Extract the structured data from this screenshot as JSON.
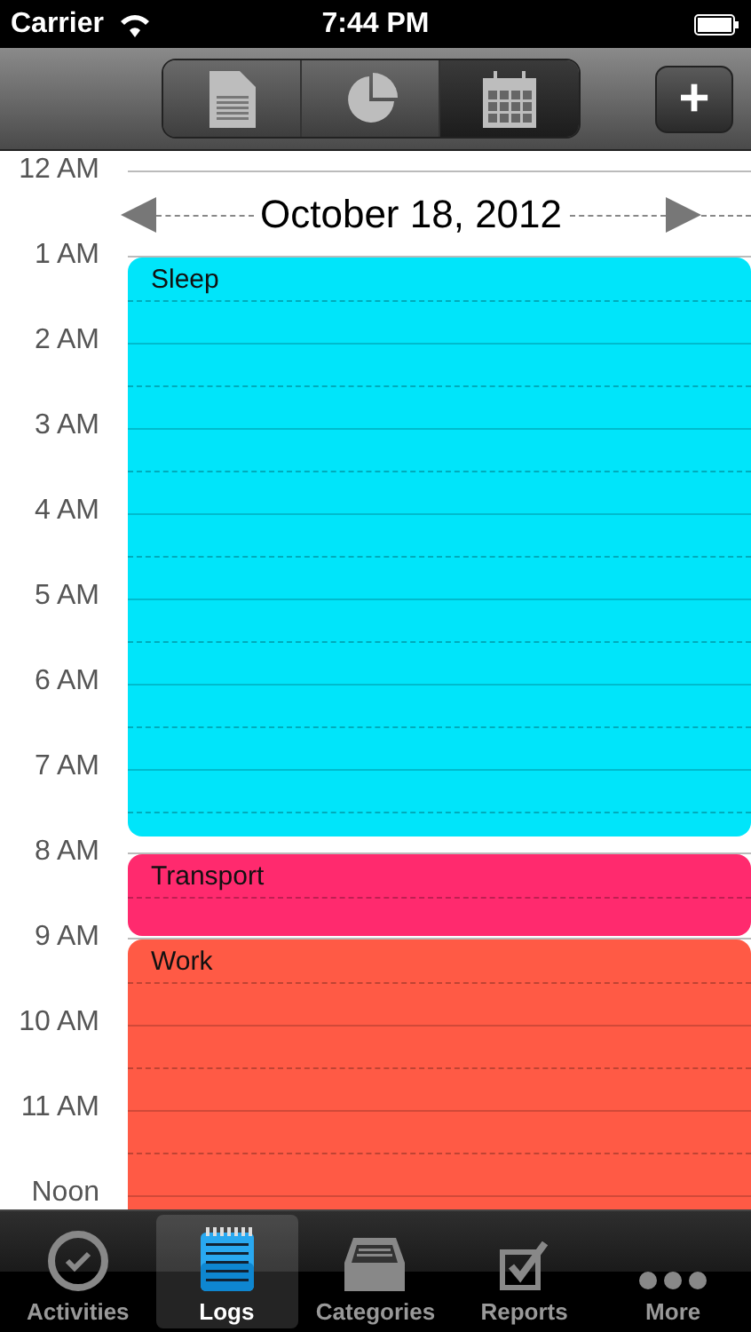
{
  "status_bar": {
    "carrier": "Carrier",
    "time": "7:44 PM"
  },
  "toolbar": {
    "segments": [
      {
        "kind": "document",
        "selected": false
      },
      {
        "kind": "pie",
        "selected": false
      },
      {
        "kind": "calendar",
        "selected": true
      }
    ],
    "add_button": "+"
  },
  "day": {
    "date": "October 18, 2012",
    "hours": [
      {
        "label": "12 AM"
      },
      {
        "label": "1 AM",
        "event": {
          "name": "Sleep",
          "color": "#00e5fa"
        }
      },
      {
        "label": "2 AM"
      },
      {
        "label": "3 AM"
      },
      {
        "label": "4 AM"
      },
      {
        "label": "5 AM"
      },
      {
        "label": "6 AM"
      },
      {
        "label": "7 AM"
      },
      {
        "label": "8 AM",
        "event": {
          "name": "Transport",
          "color": "#ff2a6e"
        }
      },
      {
        "label": "9 AM",
        "event": {
          "name": "Work",
          "color": "#ff5a45"
        }
      },
      {
        "label": "10 AM"
      },
      {
        "label": "11 AM"
      },
      {
        "label": "Noon"
      }
    ]
  },
  "tab_bar": [
    {
      "kind": "clock",
      "label": "Activities",
      "selected": false
    },
    {
      "kind": "notepad",
      "label": "Logs",
      "selected": true
    },
    {
      "kind": "tray",
      "label": "Categories",
      "selected": false
    },
    {
      "kind": "checkbox",
      "label": "Reports",
      "selected": false
    },
    {
      "kind": "dots",
      "label": "More",
      "selected": false
    }
  ]
}
